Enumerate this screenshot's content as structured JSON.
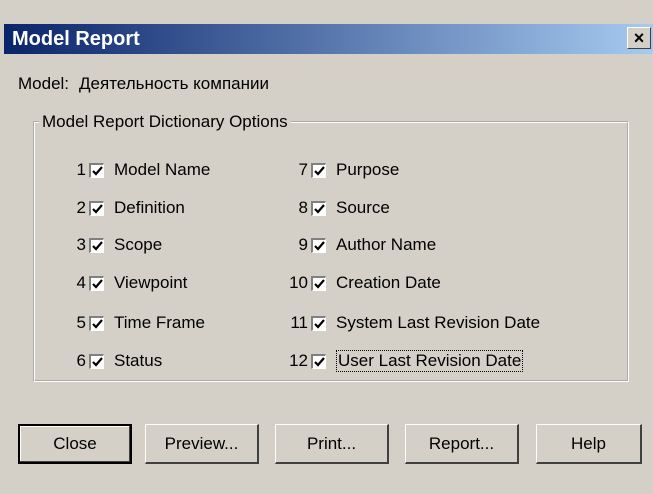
{
  "window": {
    "title": "Model Report",
    "close_glyph": "×"
  },
  "model": {
    "label": "Model:",
    "value": "Деятельность компании"
  },
  "options": {
    "legend": "Model Report Dictionary Options",
    "left": [
      {
        "num": "1",
        "label": "Model Name",
        "checked": true
      },
      {
        "num": "2",
        "label": "Definition",
        "checked": true
      },
      {
        "num": "3",
        "label": "Scope",
        "checked": true
      },
      {
        "num": "4",
        "label": "Viewpoint",
        "checked": true
      },
      {
        "num": "5",
        "label": "Time Frame",
        "checked": true
      },
      {
        "num": "6",
        "label": "Status",
        "checked": true
      }
    ],
    "right": [
      {
        "num": "7",
        "label": "Purpose",
        "checked": true
      },
      {
        "num": "8",
        "label": "Source",
        "checked": true
      },
      {
        "num": "9",
        "label": "Author Name",
        "checked": true
      },
      {
        "num": "10",
        "label": "Creation Date",
        "checked": true
      },
      {
        "num": "11",
        "label": "System Last Revision Date",
        "checked": true
      },
      {
        "num": "12",
        "label": "User Last Revision Date",
        "checked": true
      }
    ]
  },
  "buttons": {
    "close": "Close",
    "preview": "Preview...",
    "print": "Print...",
    "report": "Report...",
    "help": "Help"
  }
}
